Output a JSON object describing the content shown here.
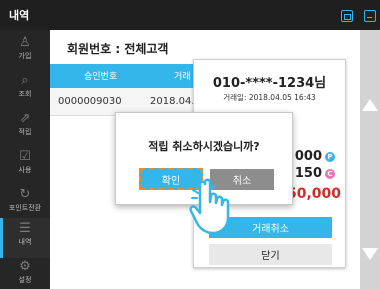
{
  "app": {
    "title": "내역"
  },
  "topbar": {
    "home_icon": "home-icon",
    "minimize_icon": "minimize-icon"
  },
  "sidebar": {
    "items": [
      {
        "label": "가입",
        "icon": "user-icon",
        "glyph": "♙"
      },
      {
        "label": "조회",
        "icon": "search-icon",
        "glyph": "⌕"
      },
      {
        "label": "적립",
        "icon": "chart-icon",
        "glyph": "⇗"
      },
      {
        "label": "사용",
        "icon": "check-box-icon",
        "glyph": "☑"
      },
      {
        "label": "포인트전환",
        "icon": "refresh-icon",
        "glyph": "↻"
      },
      {
        "label": "내역",
        "icon": "list-icon",
        "glyph": "☰",
        "active": true
      },
      {
        "label": "설정",
        "icon": "gear-icon",
        "glyph": "⚙"
      }
    ]
  },
  "main": {
    "member_title": "회원번호 : 전체고객",
    "table": {
      "headers": [
        "승인번호",
        "거래"
      ],
      "rows": [
        [
          "0000009030",
          "2018.04."
        ]
      ]
    }
  },
  "receipt": {
    "phone": "010-****-1234님",
    "trade_date": "거래일: 2018.04.05 16:43",
    "value1": "000",
    "badge1": "P",
    "value2": "150",
    "badge2": "C",
    "value3": "50,000",
    "cancel_tx_label": "거래취소",
    "close_label": "닫기"
  },
  "dialog": {
    "message": "적립 취소하시겠습니까?",
    "ok_label": "확인",
    "cancel_label": "취소"
  },
  "colors": {
    "accent": "#35b6ea",
    "sidebar_bg": "#262626",
    "highlight_border": "#e98c2d",
    "red_value": "#d12c2c",
    "pink_badge": "#e777b5"
  }
}
